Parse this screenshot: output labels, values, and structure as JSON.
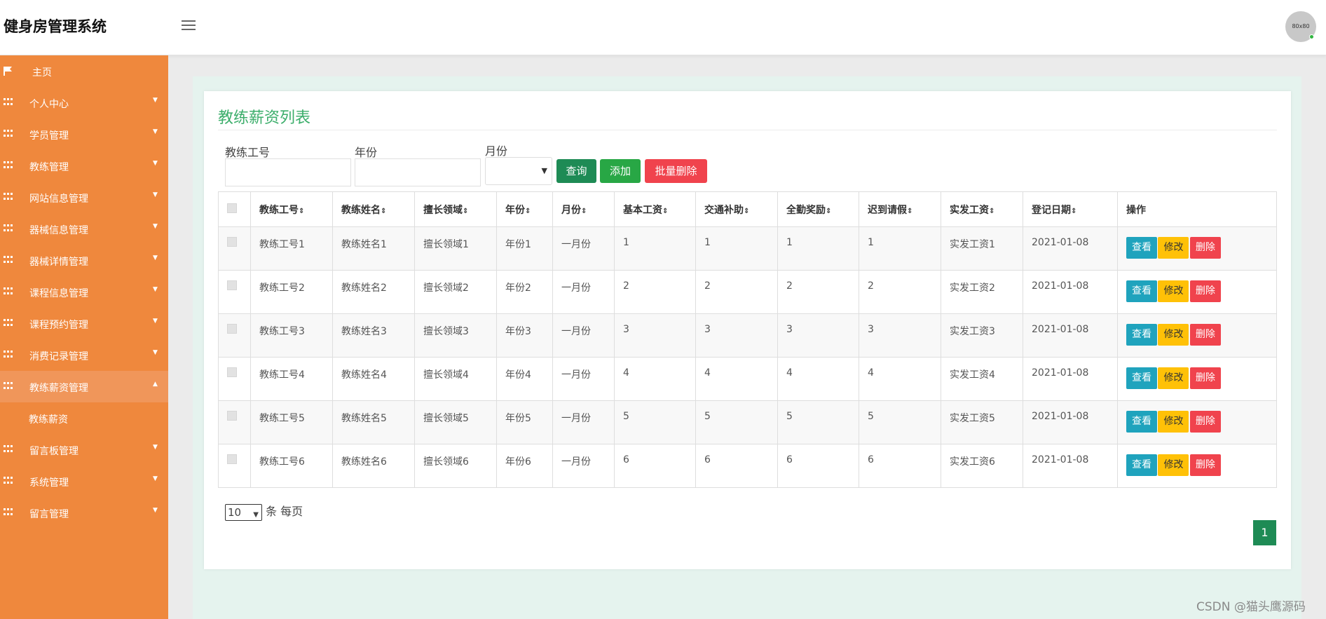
{
  "app": {
    "title": "健身房管理系统",
    "avatar_text": "80x80"
  },
  "sidebar": {
    "items": [
      {
        "label": "主页",
        "icon": "flag-icon"
      },
      {
        "label": "个人中心",
        "icon": "grid-icon"
      },
      {
        "label": "学员管理",
        "icon": "grid-icon"
      },
      {
        "label": "教练管理",
        "icon": "grid-icon"
      },
      {
        "label": "网站信息管理",
        "icon": "grid-icon"
      },
      {
        "label": "器械信息管理",
        "icon": "grid-icon"
      },
      {
        "label": "器械详情管理",
        "icon": "grid-icon"
      },
      {
        "label": "课程信息管理",
        "icon": "grid-icon"
      },
      {
        "label": "课程预约管理",
        "icon": "grid-icon"
      },
      {
        "label": "消费记录管理",
        "icon": "grid-icon"
      },
      {
        "label": "教练薪资管理",
        "icon": "grid-icon",
        "expanded": true
      },
      {
        "label": "留言板管理",
        "icon": "grid-icon"
      },
      {
        "label": "系统管理",
        "icon": "grid-icon"
      },
      {
        "label": "留言管理",
        "icon": "grid-icon"
      }
    ],
    "sub_item": "教练薪资"
  },
  "main": {
    "title": "教练薪资列表",
    "search": {
      "coach_no_label": "教练工号",
      "year_label": "年份",
      "month_label": "月份",
      "query_label": "查询",
      "add_label": "添加",
      "batch_delete_label": "批量删除"
    },
    "table": {
      "headers": [
        "教练工号",
        "教练姓名",
        "擅长领域",
        "年份",
        "月份",
        "基本工资",
        "交通补助",
        "全勤奖励",
        "迟到请假",
        "实发工资",
        "登记日期",
        "操作"
      ],
      "rows": [
        [
          "教练工号1",
          "教练姓名1",
          "擅长领域1",
          "年份1",
          "一月份",
          "1",
          "1",
          "1",
          "1",
          "实发工资1",
          "2021-01-08"
        ],
        [
          "教练工号2",
          "教练姓名2",
          "擅长领域2",
          "年份2",
          "一月份",
          "2",
          "2",
          "2",
          "2",
          "实发工资2",
          "2021-01-08"
        ],
        [
          "教练工号3",
          "教练姓名3",
          "擅长领域3",
          "年份3",
          "一月份",
          "3",
          "3",
          "3",
          "3",
          "实发工资3",
          "2021-01-08"
        ],
        [
          "教练工号4",
          "教练姓名4",
          "擅长领域4",
          "年份4",
          "一月份",
          "4",
          "4",
          "4",
          "4",
          "实发工资4",
          "2021-01-08"
        ],
        [
          "教练工号5",
          "教练姓名5",
          "擅长领域5",
          "年份5",
          "一月份",
          "5",
          "5",
          "5",
          "5",
          "实发工资5",
          "2021-01-08"
        ],
        [
          "教练工号6",
          "教练姓名6",
          "擅长领域6",
          "年份6",
          "一月份",
          "6",
          "6",
          "6",
          "6",
          "实发工资6",
          "2021-01-08"
        ]
      ],
      "actions": {
        "view": "查看",
        "edit": "修改",
        "delete": "删除"
      }
    },
    "pagination": {
      "page_size": "10",
      "page_size_suffix": "条 每页",
      "current_page": "1"
    }
  },
  "watermark": "CSDN @猫头鹰源码",
  "colors": {
    "sidebar": "#ef883d",
    "accent_green": "#1e8b55",
    "title_green": "#3cae6b",
    "view": "#1fa3bd",
    "edit": "#ffc107",
    "delete": "#f0434d"
  }
}
